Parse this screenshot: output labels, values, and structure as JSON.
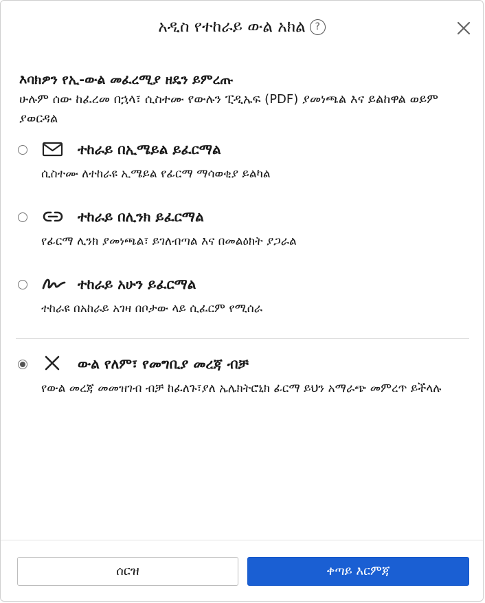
{
  "dialog": {
    "title": "አዲስ የተከራይ ውል አክል",
    "help_icon": "help-circle-icon",
    "close_icon": "close-icon"
  },
  "section": {
    "heading": "እባክዎን የኢ-ውል መፈረሚያ ዘዴን ይምረጡ",
    "description": "ሁሉም ሰው ከፈረመ በኋላ፣ ሲስተሙ የውሉን ፒዲኤፍ (PDF) ያመነጫል እና ይልከዋል ወይም ያወርዳል"
  },
  "options": [
    {
      "icon": "mail-icon",
      "title": "ተከራይ በኢሜይል ይፈርማል",
      "description": "ሲስተሙ ለተከራዩ ኢሜይል የፊርማ ማሳወቂያ ይልካል",
      "selected": false
    },
    {
      "icon": "link-icon",
      "title": "ተከራይ በሊንክ ይፈርማል",
      "description": "የፊርማ ሊንክ ያመነጫል፣ ይገለብጣል እና በመልዕክት ያጋራል",
      "selected": false
    },
    {
      "icon": "signature-icon",
      "title": "ተከራይ አሁን ይፈርማል",
      "description": "ተከራዩ በአከራይ አገዛ በቦታው ላይ ሲፈርም የሚሰራ",
      "selected": false
    },
    {
      "icon": "x-icon",
      "title": "ውል የለም፣ የመግቢያ መረጃ ብቻ",
      "description": "የውል መረጃ መመዝገብ ብቻ ከፈለጉ፣ያለ ኤሌክትሮኒክ ፊርማ ይህን አማራጭ መምረጥ ይችላሉ",
      "selected": true
    }
  ],
  "footer": {
    "cancel_label": "ሰርዝ",
    "next_label": "ቀጣይ እርምጃ"
  },
  "colors": {
    "primary": "#1a5fd3",
    "border": "#cfcfcf"
  }
}
